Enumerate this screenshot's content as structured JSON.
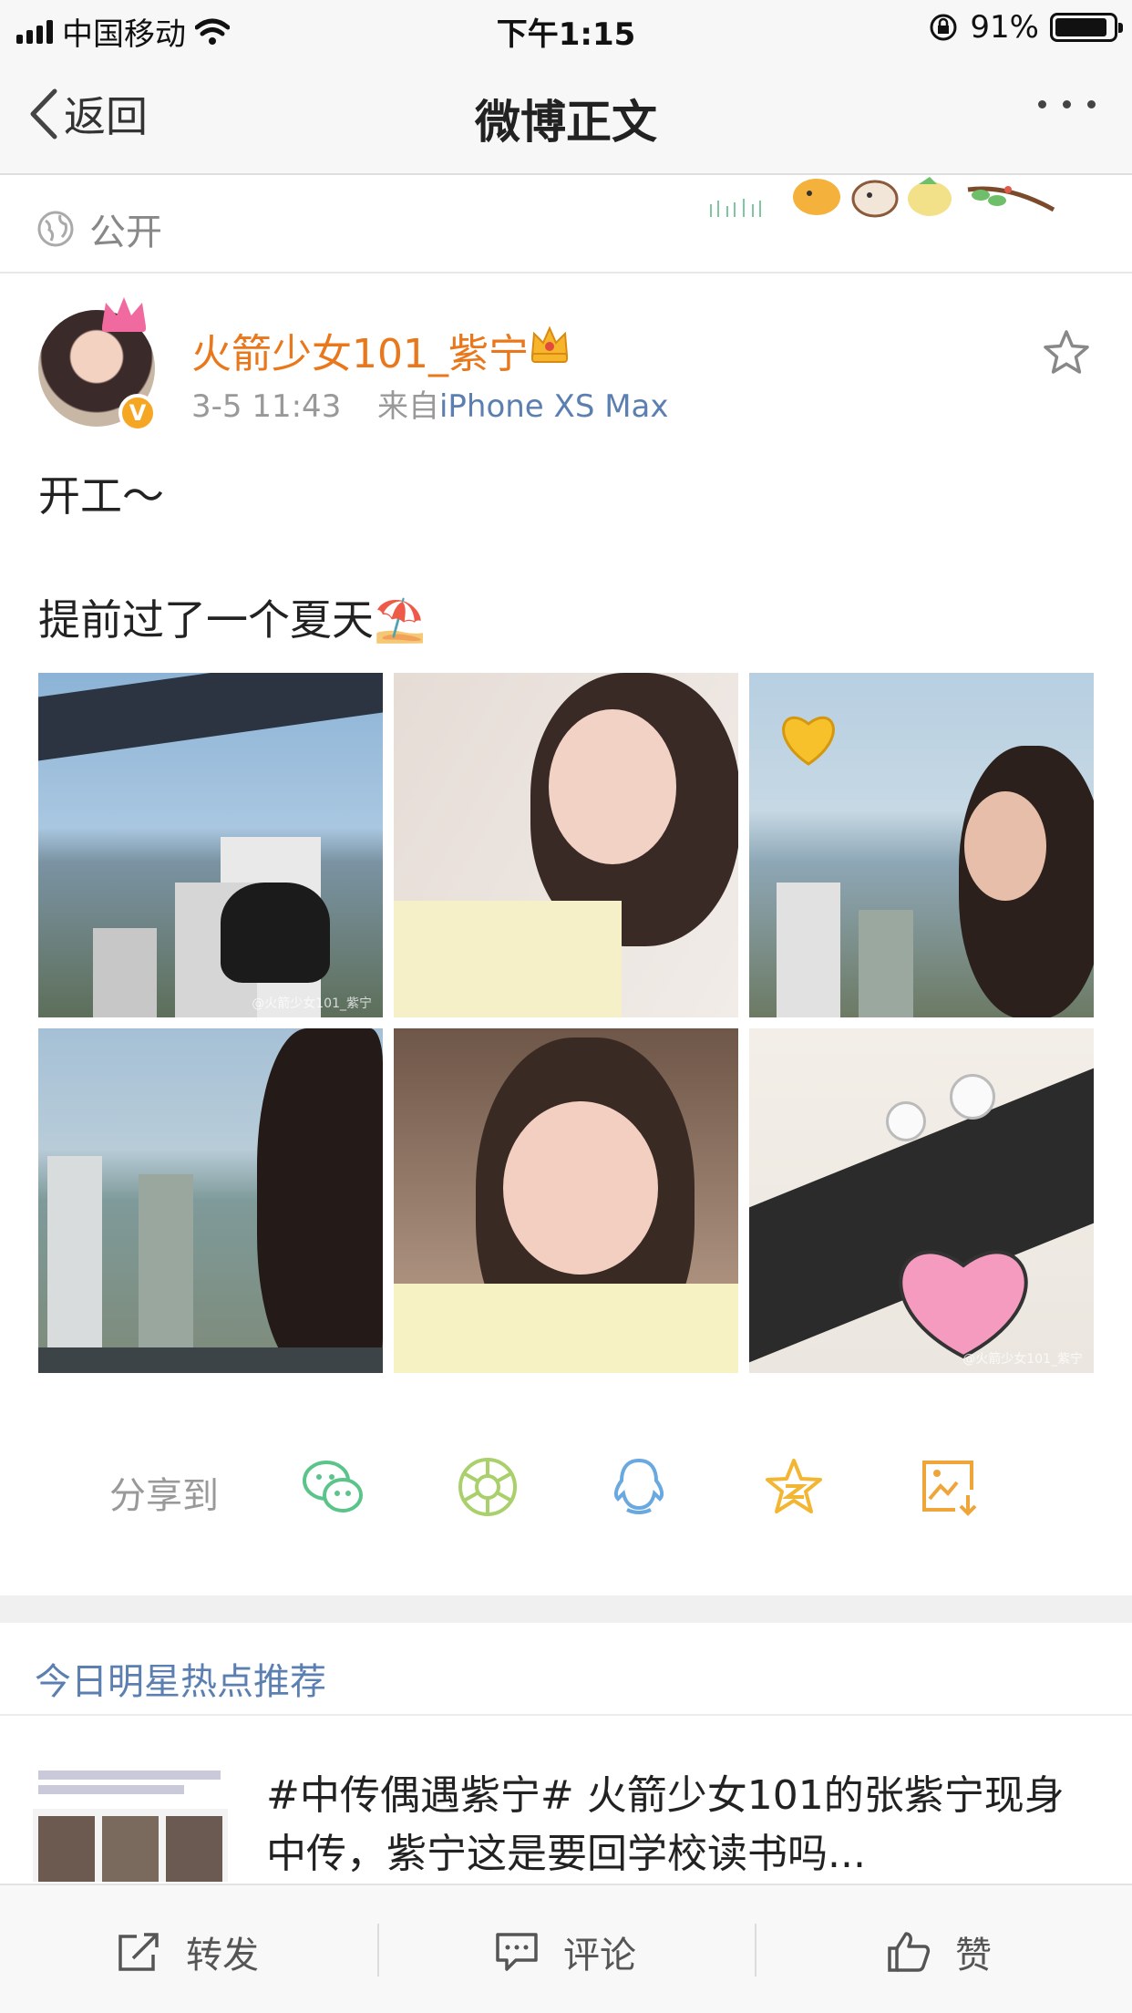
{
  "status_bar": {
    "carrier": "中国移动",
    "time": "下午1:15",
    "battery_percent": "91%",
    "battery_level": 0.91
  },
  "nav": {
    "back_label": "返回",
    "title": "微博正文"
  },
  "visibility": {
    "label": "公开"
  },
  "post": {
    "author": "火箭少女101_紫宁",
    "time": "3-5 11:43",
    "source_prefix": "来自",
    "source": "iPhone XS Max",
    "text_lines": [
      "开工～",
      "提前过了一个夏天⛱️"
    ],
    "photo_watermarks": [
      "@火箭少女101_紫宁",
      "",
      "",
      "",
      "",
      "@火箭少女101_紫宁"
    ]
  },
  "share": {
    "label": "分享到",
    "targets": [
      "wechat-icon",
      "moments-icon",
      "qq-icon",
      "qzone-icon",
      "save-image-icon"
    ]
  },
  "recommend": {
    "header": "今日明星热点推荐",
    "title": "#中传偶遇紫宁# 火箭少女101的张紫宁现身中传，紫宁这是要回学校读书吗..."
  },
  "toolbar": {
    "repost": "转发",
    "comment": "评论",
    "like": "赞"
  },
  "colors": {
    "author_orange": "#e8781b",
    "link_blue": "#5b7fb0",
    "meta_gray": "#999999"
  }
}
